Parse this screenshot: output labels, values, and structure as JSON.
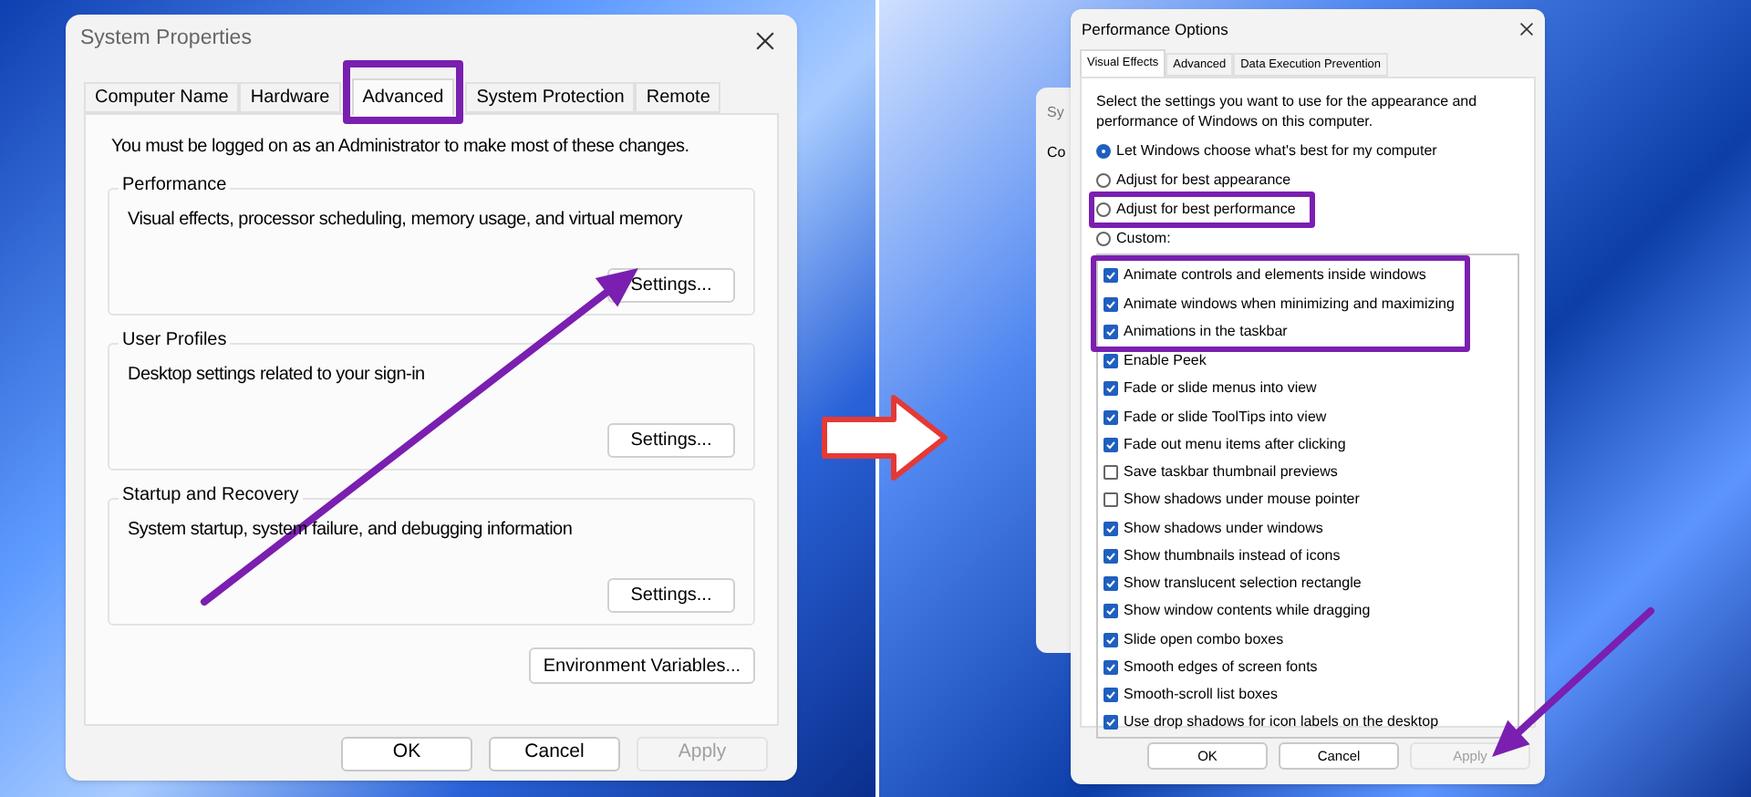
{
  "system_properties": {
    "title": "System Properties",
    "tabs": [
      {
        "label": "Computer Name",
        "selected": false
      },
      {
        "label": "Hardware",
        "selected": false
      },
      {
        "label": "Advanced",
        "selected": true,
        "highlighted": true
      },
      {
        "label": "System Protection",
        "selected": false
      },
      {
        "label": "Remote",
        "selected": false
      }
    ],
    "notice": "You must be logged on as an Administrator to make most of these changes.",
    "groups": [
      {
        "title": "Performance",
        "description": "Visual effects, processor scheduling, memory usage, and virtual memory",
        "button": "Settings..."
      },
      {
        "title": "User Profiles",
        "description": "Desktop settings related to your sign-in",
        "button": "Settings..."
      },
      {
        "title": "Startup and Recovery",
        "description": "System startup, system failure, and debugging information",
        "button": "Settings..."
      }
    ],
    "environment_button": "Environment Variables...",
    "footer_buttons": [
      {
        "label": "OK",
        "disabled": false
      },
      {
        "label": "Cancel",
        "disabled": false
      },
      {
        "label": "Apply",
        "disabled": true
      }
    ]
  },
  "background_window": {
    "title": "Sy",
    "tab": "Co"
  },
  "performance_options": {
    "title": "Performance Options",
    "tabs": [
      {
        "label": "Visual Effects",
        "selected": true
      },
      {
        "label": "Advanced",
        "selected": false
      },
      {
        "label": "Data Execution Prevention",
        "selected": false
      }
    ],
    "intro": "Select the settings you want to use for the appearance and performance of Windows on this computer.",
    "options": [
      {
        "label": "Let Windows choose what's best for my computer",
        "selected": true
      },
      {
        "label": "Adjust for best appearance",
        "selected": false
      },
      {
        "label": "Adjust for best performance",
        "selected": false,
        "highlighted": true
      },
      {
        "label": "Custom:",
        "selected": false
      }
    ],
    "effects": [
      {
        "label": "Animate controls and elements inside windows",
        "checked": true,
        "highlighted": true
      },
      {
        "label": "Animate windows when minimizing and maximizing",
        "checked": true,
        "highlighted": true
      },
      {
        "label": "Animations in the taskbar",
        "checked": true,
        "highlighted": true
      },
      {
        "label": "Enable Peek",
        "checked": true
      },
      {
        "label": "Fade or slide menus into view",
        "checked": true
      },
      {
        "label": "Fade or slide ToolTips into view",
        "checked": true
      },
      {
        "label": "Fade out menu items after clicking",
        "checked": true
      },
      {
        "label": "Save taskbar thumbnail previews",
        "checked": false
      },
      {
        "label": "Show shadows under mouse pointer",
        "checked": false
      },
      {
        "label": "Show shadows under windows",
        "checked": true
      },
      {
        "label": "Show thumbnails instead of icons",
        "checked": true
      },
      {
        "label": "Show translucent selection rectangle",
        "checked": true
      },
      {
        "label": "Show window contents while dragging",
        "checked": true
      },
      {
        "label": "Slide open combo boxes",
        "checked": true
      },
      {
        "label": "Smooth edges of screen fonts",
        "checked": true
      },
      {
        "label": "Smooth-scroll list boxes",
        "checked": true
      },
      {
        "label": "Use drop shadows for icon labels on the desktop",
        "checked": true
      }
    ],
    "footer_buttons": [
      {
        "label": "OK",
        "disabled": false
      },
      {
        "label": "Cancel",
        "disabled": false
      },
      {
        "label": "Apply",
        "disabled": true
      }
    ]
  }
}
